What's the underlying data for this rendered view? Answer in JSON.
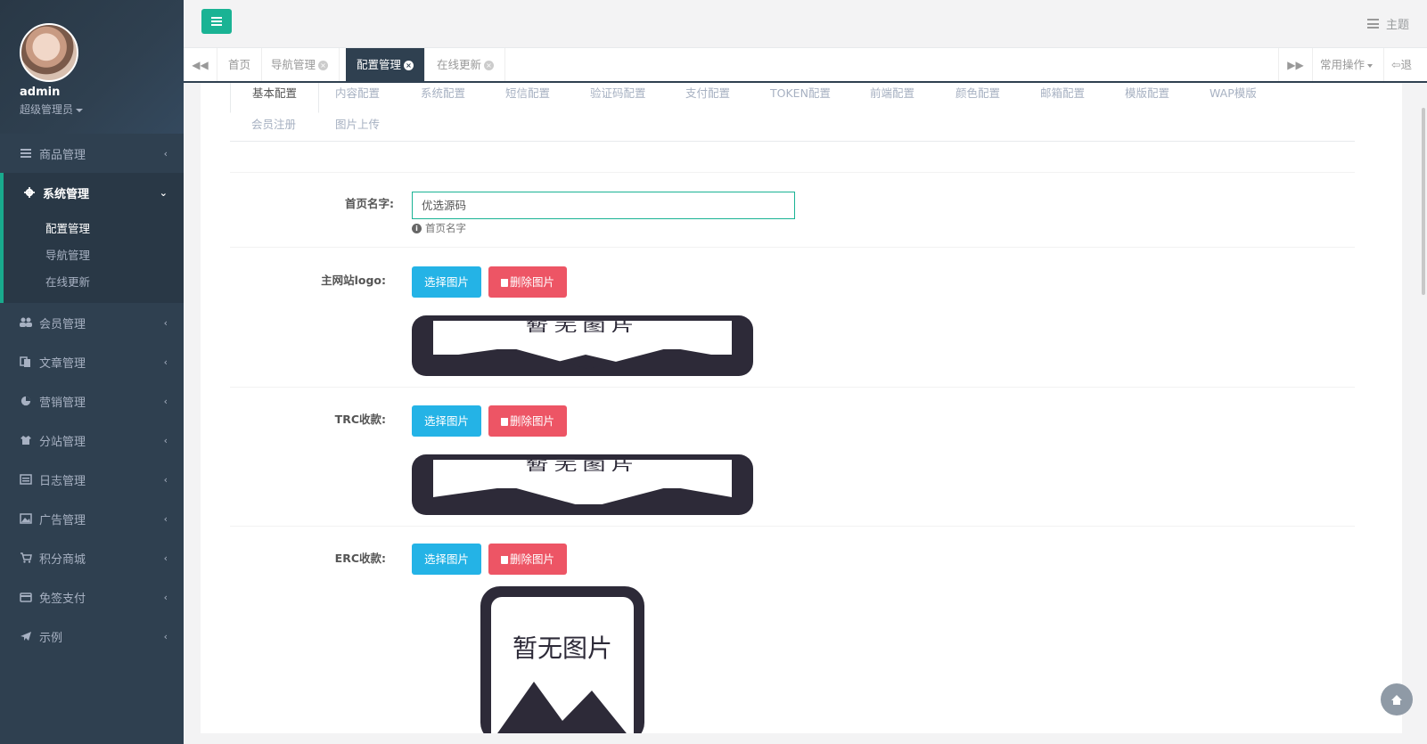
{
  "sidebar": {
    "user": {
      "name": "admin",
      "role": "超级管理员"
    },
    "menu": [
      {
        "label": "商品管理",
        "icon": "list-icon"
      },
      {
        "label": "系统管理",
        "icon": "gear-icon"
      },
      {
        "label": "会员管理",
        "icon": "users-icon"
      },
      {
        "label": "文章管理",
        "icon": "copy-icon"
      },
      {
        "label": "营销管理",
        "icon": "pie-chart-icon"
      },
      {
        "label": "分站管理",
        "icon": "shirt-icon"
      },
      {
        "label": "日志管理",
        "icon": "list-alt-icon"
      },
      {
        "label": "广告管理",
        "icon": "picture-icon"
      },
      {
        "label": "积分商城",
        "icon": "cart-icon"
      },
      {
        "label": "免签支付",
        "icon": "credit-card-icon"
      },
      {
        "label": "示例",
        "icon": "paper-plane-icon"
      }
    ],
    "submenu": [
      {
        "label": "配置管理"
      },
      {
        "label": "导航管理"
      },
      {
        "label": "在线更新"
      }
    ]
  },
  "topbar": {
    "theme_label": "主题"
  },
  "tabs": [
    {
      "label": "首页"
    },
    {
      "label": "导航管理"
    },
    {
      "label": "配置管理"
    },
    {
      "label": "在线更新"
    }
  ],
  "tab_ops": {
    "common_ops": "常用操作",
    "logout": "退出"
  },
  "config_tabs": [
    "基本配置",
    "内容配置",
    "系统配置",
    "短信配置",
    "验证码配置",
    "支付配置",
    "TOKEN配置",
    "前端配置",
    "颜色配置",
    "邮箱配置",
    "模版配置",
    "WAP模版",
    "会员注册",
    "图片上传"
  ],
  "form": {
    "homepage_name": {
      "label": "首页名字:",
      "value": "优选源码",
      "help": "首页名字"
    },
    "main_logo": {
      "label": "主网站logo:"
    },
    "trc": {
      "label": "TRC收款:"
    },
    "erc": {
      "label": "ERC收款:"
    },
    "select_image": "选择图片",
    "delete_image": "删除图片",
    "no_image": "暂无图片"
  },
  "colors": {
    "sidebar_bg": "#2f4050",
    "accent_green": "#1ab394",
    "select_blue": "#24b3e6",
    "delete_red": "#ed5565"
  }
}
